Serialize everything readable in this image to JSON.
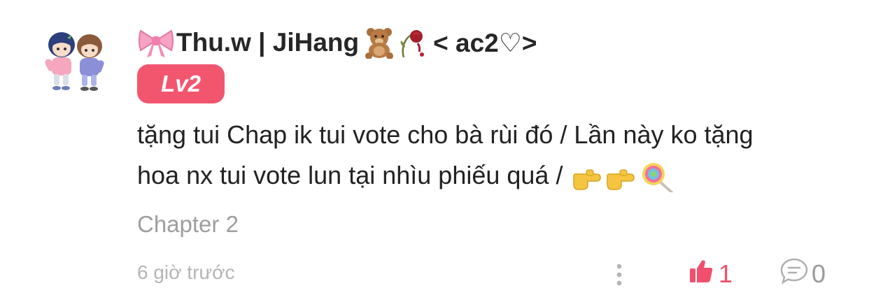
{
  "comment": {
    "author": {
      "name": "Thu.w | JiHang",
      "suffix": "< ac2♡>",
      "avatar": "chibi-couple-avatar",
      "name_icons": [
        "ribbon-icon",
        "teddy-bear-icon",
        "wilted-rose-icon"
      ]
    },
    "level_badge": "Lv2",
    "text_lines": [
      "tặng tui Chap ik tui vote cho bà rùi đó / Lần này ko tặng",
      "hoa nx tui vote lun tại nhìu phiếu quá / "
    ],
    "text_icons": [
      "pointing-right-icon",
      "pointing-right-icon",
      "lollipop-icon"
    ],
    "chapter": "Chapter 2",
    "timestamp": "6 giờ trước",
    "likes": "1",
    "replies": "0",
    "colors": {
      "accent": "#f2566f",
      "like": "#f0506e",
      "muted": "#9e9e9e"
    }
  }
}
